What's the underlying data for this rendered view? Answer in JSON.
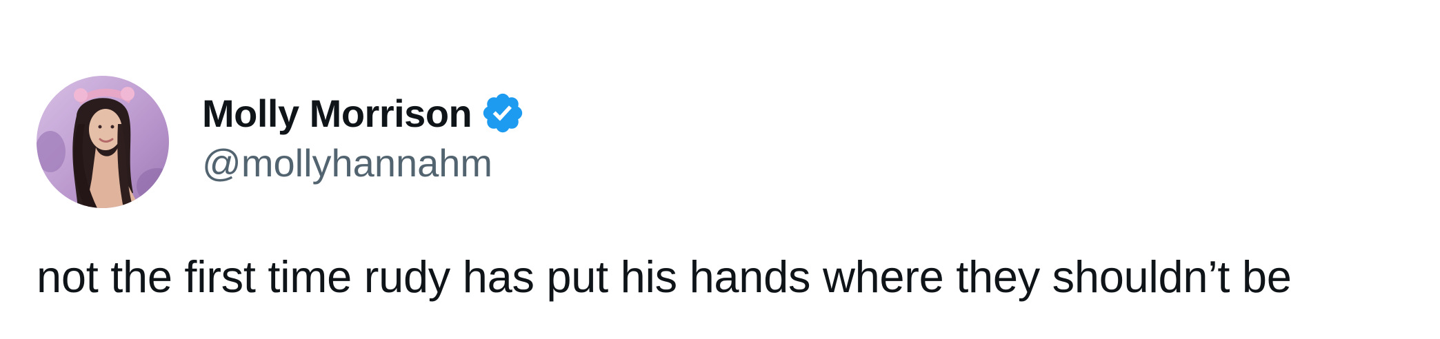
{
  "tweet": {
    "author": {
      "display_name": "Molly Morrison",
      "handle": "@mollyhannahm",
      "verified": true,
      "avatar_icon": "profile-photo",
      "verified_icon": "verified-badge-icon"
    },
    "text": "not the first time rudy has put his hands where they shouldn’t be"
  },
  "colors": {
    "name": "#0f1419",
    "handle": "#536471",
    "verified_badge": "#1d9bf0",
    "avatar_bg": "#c8a9d8"
  }
}
